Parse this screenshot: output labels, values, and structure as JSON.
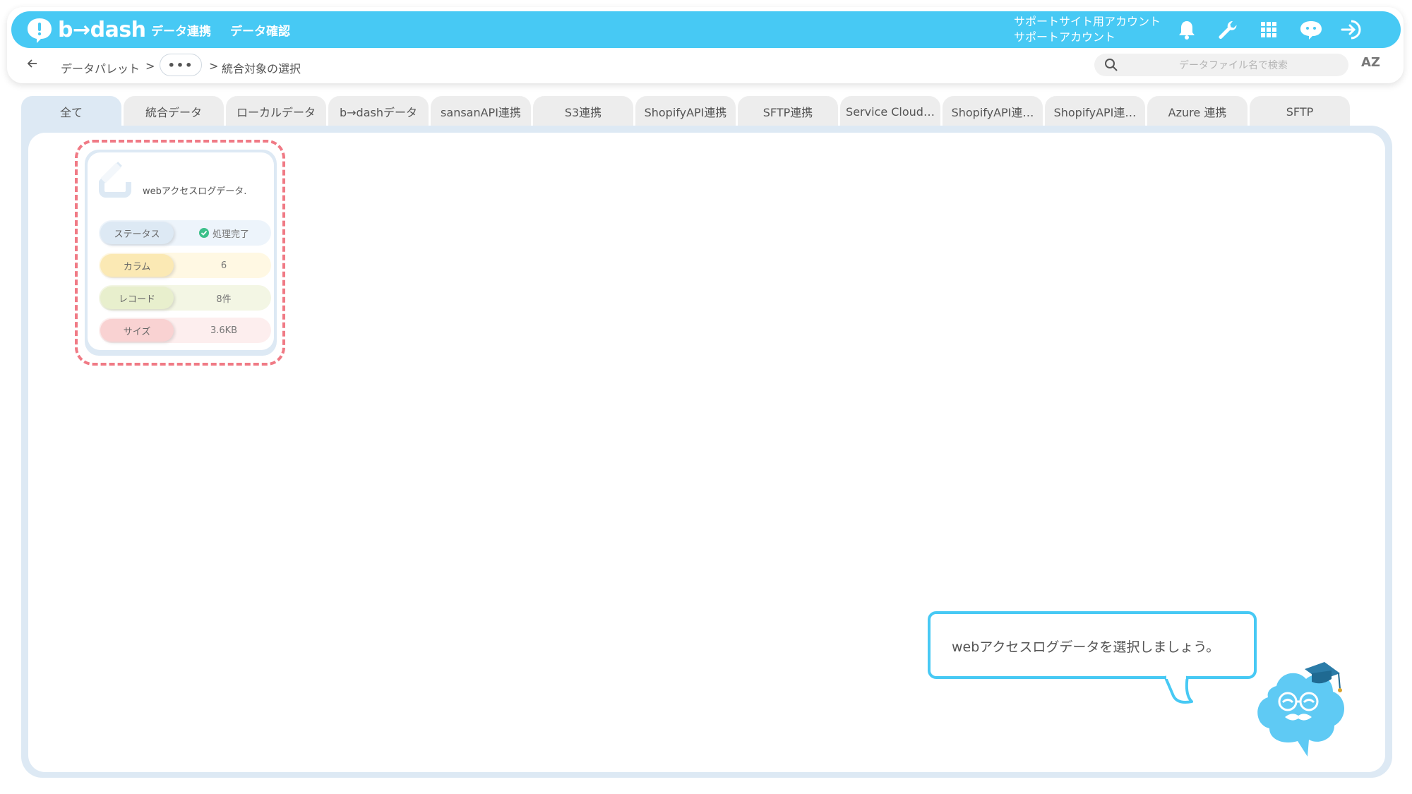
{
  "header": {
    "logo_text": "b→dash",
    "nav": [
      "データ連携",
      "データ確認"
    ],
    "account_line1": "サポートサイト用アカウント",
    "account_line2": "サポートアカウント",
    "icons": [
      "bell-icon",
      "wrench-icon",
      "grid-icon",
      "support-chat-icon",
      "logout-icon"
    ]
  },
  "breadcrumb": {
    "root": "データパレット",
    "sep1": ">",
    "more": "•••",
    "sep2": ">",
    "current": "統合対象の選択"
  },
  "search": {
    "placeholder": "データファイル名で検索"
  },
  "sort": {
    "label": "AZ"
  },
  "tabs": [
    {
      "label": "全て"
    },
    {
      "label": "統合データ"
    },
    {
      "label": "ローカルデータ"
    },
    {
      "label": "b→dashデータ"
    },
    {
      "label": "sansanAPI連携"
    },
    {
      "label": "S3連携"
    },
    {
      "label": "ShopifyAPI連携"
    },
    {
      "label": "SFTP連携"
    },
    {
      "label": "Service Cloud…"
    },
    {
      "label": "ShopifyAPI連…"
    },
    {
      "label": "ShopifyAPI連…"
    },
    {
      "label": "Azure 連携"
    },
    {
      "label": "SFTP"
    }
  ],
  "card": {
    "title": "webアクセスログデータ.",
    "status_label": "ステータス",
    "status_value": "処理完了",
    "columns_label": "カラム",
    "columns_value": "6",
    "records_label": "レコード",
    "records_value": "8件",
    "size_label": "サイズ",
    "size_value": "3.6KB"
  },
  "guide": {
    "message": "webアクセスログデータを選択しましょう。"
  },
  "colors": {
    "accent": "#47c9f4",
    "highlight": "#f07a85",
    "panel": "#dde9f4",
    "success": "#3cc08a"
  }
}
